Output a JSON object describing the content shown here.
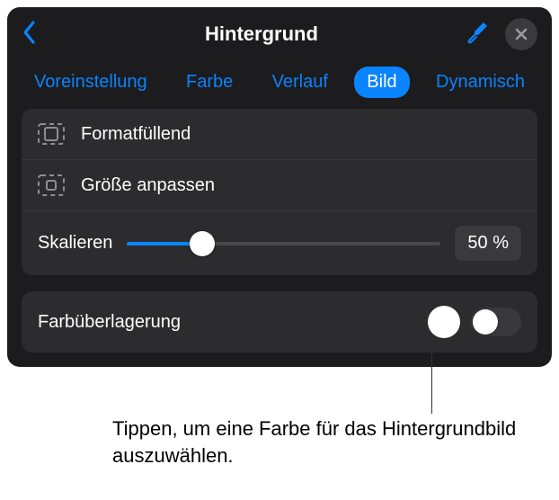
{
  "header": {
    "title": "Hintergrund"
  },
  "tabs": {
    "preset": "Voreinstellung",
    "color": "Farbe",
    "gradient": "Verlauf",
    "image": "Bild",
    "dynamic": "Dynamisch",
    "active": "image"
  },
  "fill": {
    "fill_screen": "Formatfüllend",
    "fit": "Größe anpassen"
  },
  "scale": {
    "label": "Skalieren",
    "value": "50 %",
    "percent": 50
  },
  "overlay": {
    "label": "Farbüberlagerung",
    "enabled": false,
    "swatch_color": "#ffffff"
  },
  "callout": {
    "text": "Tippen, um eine Farbe für das Hintergrundbild auszuwählen."
  }
}
